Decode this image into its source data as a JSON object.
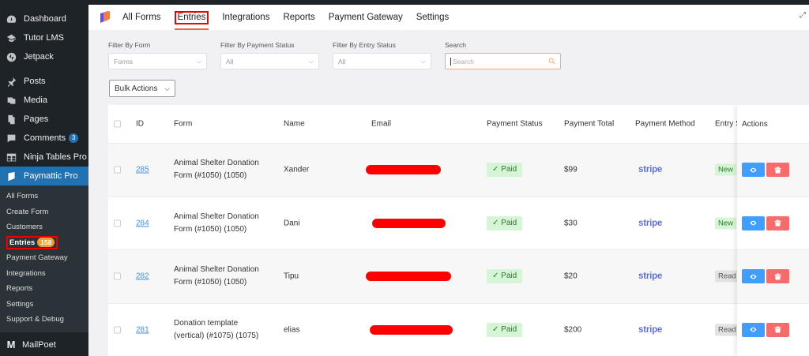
{
  "sidebar": {
    "items": [
      {
        "label": "Dashboard",
        "icon": "dashboard-icon"
      },
      {
        "label": "Tutor LMS",
        "icon": "graduation-cap-icon"
      },
      {
        "label": "Jetpack",
        "icon": "jetpack-icon"
      },
      {
        "label": "Posts",
        "icon": "pin-icon"
      },
      {
        "label": "Media",
        "icon": "media-icon"
      },
      {
        "label": "Pages",
        "icon": "pages-icon"
      },
      {
        "label": "Comments",
        "icon": "comments-icon",
        "badge": "3"
      },
      {
        "label": "Ninja Tables Pro",
        "icon": "table-icon"
      },
      {
        "label": "Paymattic Pro",
        "icon": "paymattic-icon"
      }
    ],
    "submenu": [
      "All Forms",
      "Create Form",
      "Customers",
      "Entries",
      "Payment Gateway",
      "Integrations",
      "Reports",
      "Settings",
      "Support & Debug"
    ],
    "entries_badge": "158",
    "mailpoet": "MailPoet"
  },
  "topnav": {
    "tabs": [
      "All Forms",
      "Entries",
      "Integrations",
      "Reports",
      "Payment Gateway",
      "Settings"
    ],
    "active_tab": "Entries"
  },
  "filters": {
    "form": {
      "label": "Filter By Form",
      "value": "Forms"
    },
    "payment_status": {
      "label": "Filter By Payment Status",
      "value": "All"
    },
    "entry_status": {
      "label": "Filter By Entry Status",
      "value": "All"
    },
    "search": {
      "label": "Search",
      "placeholder": "Search"
    }
  },
  "bulk_actions": "Bulk Actions",
  "table": {
    "headers": [
      "ID",
      "Form",
      "Name",
      "Email",
      "Payment Status",
      "Payment Total",
      "Payment Method",
      "Entry Status",
      "Actions"
    ],
    "rows": [
      {
        "id": "285",
        "form": "Animal Shelter Donation Form (#1050) (1050)",
        "name": "Xander",
        "payment_status": "Paid",
        "total": "$99",
        "method": "stripe",
        "entry_status": "New"
      },
      {
        "id": "284",
        "form": "Animal Shelter Donation Form (#1050) (1050)",
        "name": "Dani",
        "payment_status": "Paid",
        "total": "$30",
        "method": "stripe",
        "entry_status": "New"
      },
      {
        "id": "282",
        "form": "Animal Shelter Donation Form (#1050) (1050)",
        "name": "Tipu",
        "payment_status": "Paid",
        "total": "$20",
        "method": "stripe",
        "entry_status": "Read"
      },
      {
        "id": "281",
        "form": "Donation template (vertical) (#1075) (1075)",
        "name": "elias",
        "payment_status": "Paid",
        "total": "$200",
        "method": "stripe",
        "entry_status": "Read"
      }
    ]
  },
  "colors": {
    "sidebar_bg": "#1d2327",
    "active_blue": "#2271b1",
    "accent_orange": "#e46a3b",
    "paid_bg": "#d6f5d6",
    "view_btn": "#409eff",
    "delete_btn": "#f56c6c",
    "stripe": "#5f6fd8",
    "redaction": "#ff0000"
  }
}
